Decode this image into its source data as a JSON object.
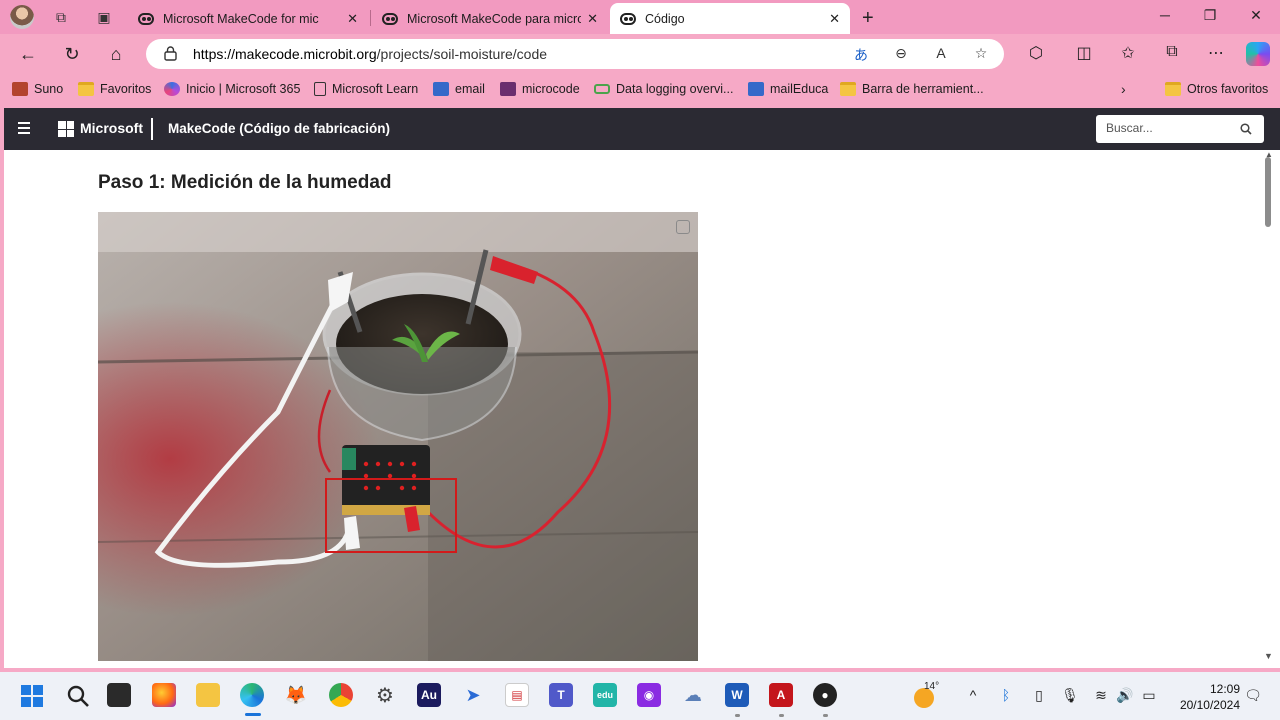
{
  "browser": {
    "tabs": [
      {
        "title": "Microsoft MakeCode for mic",
        "active": false
      },
      {
        "title": "Microsoft MakeCode para micro:",
        "active": false
      },
      {
        "title": "Código",
        "active": true
      }
    ],
    "address": {
      "host": "https://makecode.microbit.org",
      "path": "/projects/soil-moisture/code"
    },
    "bookmarks": [
      {
        "label": "Suno",
        "icon": "suno-icon"
      },
      {
        "label": "Favoritos",
        "icon": "folder-icon"
      },
      {
        "label": "Inicio | Microsoft 365",
        "icon": "m365-icon"
      },
      {
        "label": "Microsoft Learn",
        "icon": "document-icon"
      },
      {
        "label": "email",
        "icon": "mail-icon"
      },
      {
        "label": "microcode",
        "icon": "microcode-icon"
      },
      {
        "label": "Data logging overvi...",
        "icon": "data-logging-icon"
      },
      {
        "label": "mailEduca",
        "icon": "mail-icon"
      },
      {
        "label": "Barra de herramient...",
        "icon": "folder-icon"
      },
      {
        "label": "Otros favoritos",
        "icon": "folder-icon"
      }
    ]
  },
  "makecode": {
    "brand": "Microsoft",
    "title": "MakeCode (Código de fabricación)",
    "search_placeholder": "Buscar..."
  },
  "content": {
    "step_title": "Paso 1: Medición de la humedad"
  },
  "taskbar": {
    "weather_temp": "14°",
    "time": "12:09",
    "date": "20/10/2024",
    "colors": {
      "accent": "#1a73d9",
      "makecode_header": "#2b2a33",
      "browser_chrome": "#f6a9c6"
    }
  }
}
